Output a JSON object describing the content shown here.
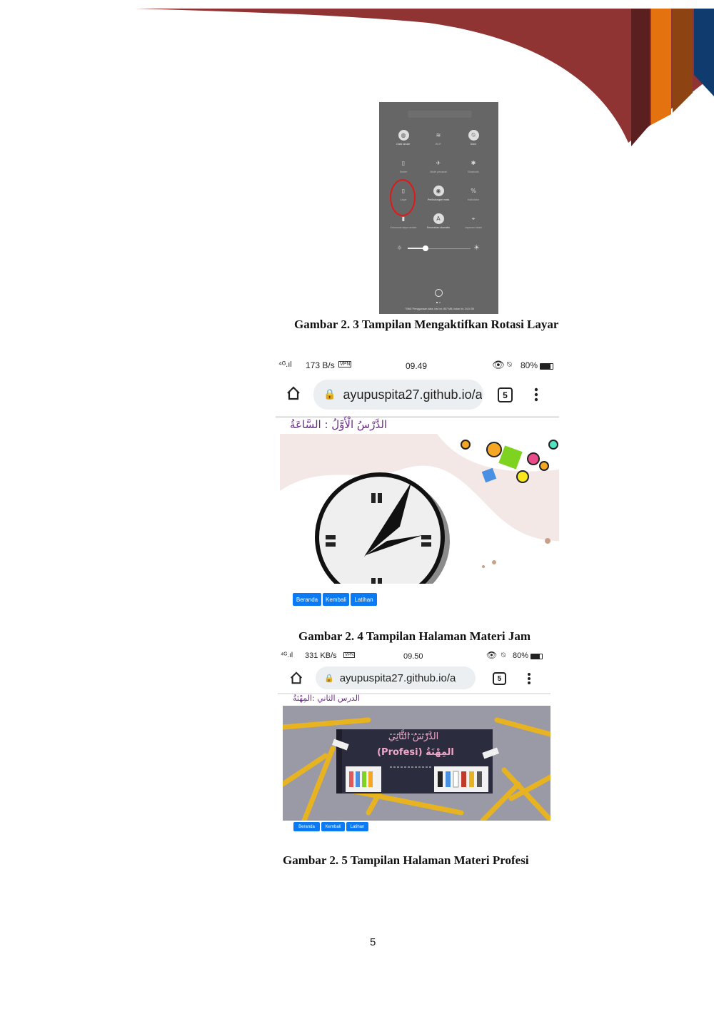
{
  "quick_settings": {
    "tiles": [
      {
        "label": "Data seluler",
        "icon": "globe-icon",
        "active": true
      },
      {
        "label": "Wi-Fi",
        "icon": "wifi-icon",
        "active": false
      },
      {
        "label": "Diam",
        "icon": "bell-off-icon",
        "active": true
      },
      {
        "label": "Senter",
        "icon": "flashlight-icon",
        "active": false
      },
      {
        "label": "Mode pesawat",
        "icon": "airplane-icon",
        "active": false
      },
      {
        "label": "Bluetooth",
        "icon": "bluetooth-icon",
        "active": false
      },
      {
        "label": "Layar",
        "icon": "rotate-lock-icon",
        "active": false
      },
      {
        "label": "Perlindungan mata",
        "icon": "eye-icon",
        "active": true
      },
      {
        "label": "Kalkulator",
        "icon": "percent-icon",
        "active": false
      },
      {
        "label": "Konsumsi daya rendah",
        "icon": "battery-icon",
        "active": false
      },
      {
        "label": "Kecerahan otomatis",
        "icon": "auto-brightness-icon",
        "active": true
      },
      {
        "label": "Layanan lokasi",
        "icon": "location-icon",
        "active": false
      }
    ],
    "brightness_level": 0.28,
    "footer": "\"SIM1\"Penggunaan data, hari ini: 857 MB, bulan ini: 24,0 GB"
  },
  "caption_1": "Gambar 2. 3 Tampilan Mengaktifkan Rotasi Layar",
  "screenshot_1": {
    "status_left": "173 B/s",
    "vpn": "VPN",
    "time": "09.49",
    "battery": "80%",
    "url": "ayupuspita27.github.io/a",
    "tab_count": "5",
    "heading": "الدَّرْسُ الْأَوَّلُ : السَّاعَةُ",
    "buttons": [
      "Beranda",
      "Kembali",
      "Latihan"
    ]
  },
  "caption_2": "Gambar 2. 4 Tampilan Halaman Materi Jam",
  "screenshot_2": {
    "status_left": "331 KB/s",
    "vpn": "VPN",
    "time": "09.50",
    "battery": "80%",
    "url": "ayupuspita27.github.io/a",
    "tab_count": "5",
    "heading": "الدرس الثاني :المِهْنَةُ",
    "banner_title": "الدَّرْسُ الثَّانِي",
    "banner_sub": "(Profesi) المِهْنَةُ",
    "buttons": [
      "Beranda",
      "Kembali",
      "Latihan"
    ]
  },
  "caption_3": "Gambar 2. 5 Tampilan Halaman Materi Profesi",
  "page_number": "5",
  "colors": {
    "banner_red": "#8f3333",
    "stripe_dark": "#5c1f1f",
    "stripe_orange": "#e3720f",
    "stripe_brown": "#8e4312",
    "stripe_navy": "#0f3b6e",
    "button_blue": "#0a7bf5"
  }
}
